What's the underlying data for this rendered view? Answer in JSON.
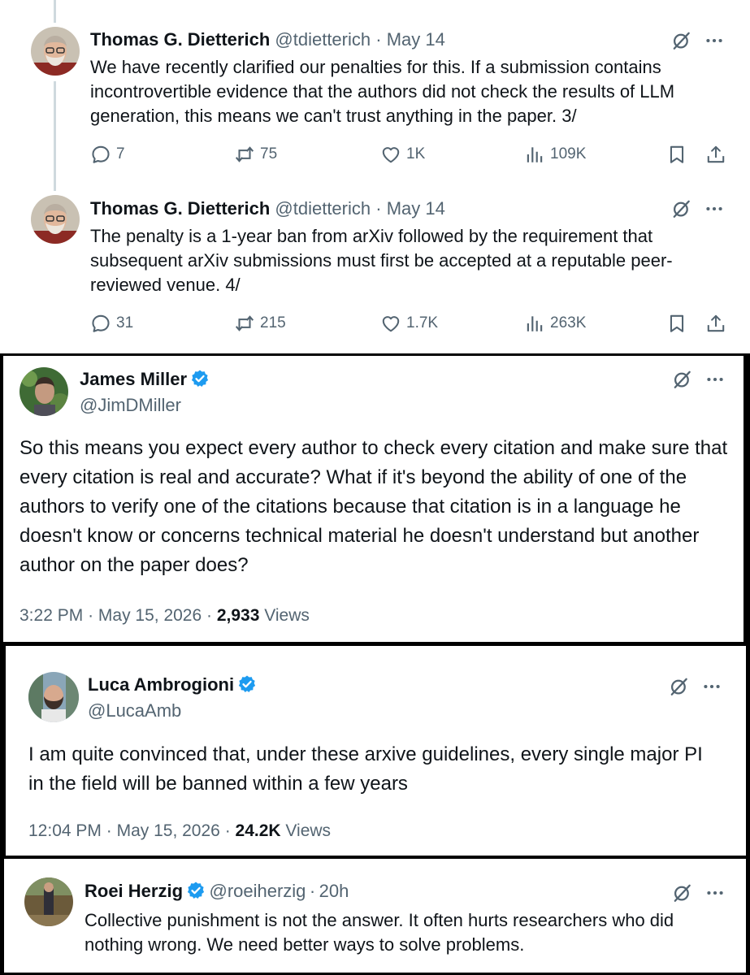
{
  "tweets": [
    {
      "name": "Thomas G. Dietterich",
      "handle": "@tdietterich",
      "sep": "·",
      "date": "May 14",
      "text": "We have recently clarified our penalties for this. If a submission contains incontrovertible evidence that the authors did not check the results of LLM generation, this means we can't trust anything in the paper. 3/",
      "replies": "7",
      "reposts": "75",
      "likes": "1K",
      "views": "109K"
    },
    {
      "name": "Thomas G. Dietterich",
      "handle": "@tdietterich",
      "sep": "·",
      "date": "May 14",
      "text": "The penalty is a 1-year ban from arXiv followed by the requirement that subsequent arXiv submissions must first be accepted at a reputable peer-reviewed venue. 4/",
      "replies": "31",
      "reposts": "215",
      "likes": "1.7K",
      "views": "263K"
    },
    {
      "name": "James Miller",
      "handle": "@JimDMiller",
      "text": "So this means you expect every author to check every citation and make sure that every citation is real and accurate? What if it's beyond the ability of one of the authors to verify one of the citations because that citation is in a language he doesn't know or concerns technical material he doesn't understand but another author on the paper does?",
      "time": "3:22 PM",
      "sep": "·",
      "date": "May 15, 2026",
      "sep2": "·",
      "views_count": "2,933",
      "views_label": "Views"
    },
    {
      "name": "Luca Ambrogioni",
      "handle": "@LucaAmb",
      "text": "I am quite convinced that, under these arxive guidelines, every single major PI in the field will be banned within a few years",
      "time": "12:04 PM",
      "sep": "·",
      "date": "May 15, 2026",
      "sep2": "·",
      "views_count": "24.2K",
      "views_label": "Views"
    },
    {
      "name": "Roei Herzig",
      "handle": "@roeiherzig",
      "sep": "·",
      "date": "20h",
      "text": "Collective punishment is not the answer. It often hurts researchers who did nothing wrong. We need better ways to solve problems."
    }
  ],
  "more_label": "···",
  "colors": {
    "text": "#0f1419",
    "muted": "#536471",
    "verified": "#1d9bf0",
    "thread_line": "#cfd9de"
  },
  "icons": [
    "grok-icon",
    "more-icon",
    "reply-icon",
    "repost-icon",
    "like-icon",
    "views-icon",
    "bookmark-icon",
    "share-icon",
    "verified-badge-icon"
  ]
}
